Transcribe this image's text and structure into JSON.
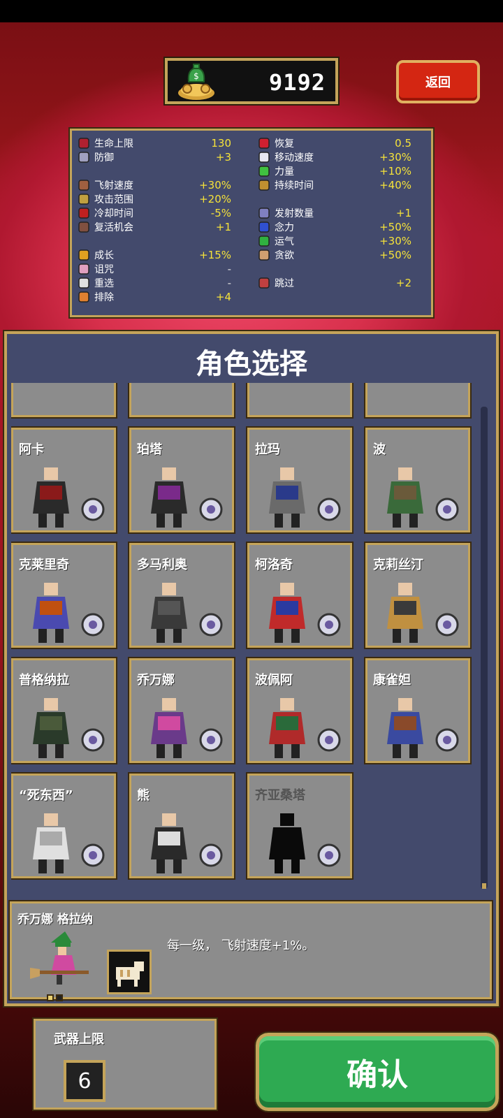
{
  "header": {
    "gold": "9192",
    "back_label": "返回"
  },
  "stats": {
    "left": [
      {
        "label": "生命上限",
        "value": "130",
        "icon": "heart-icon"
      },
      {
        "label": "防御",
        "value": "+3",
        "icon": "armor-icon"
      },
      {
        "label": "飞射速度",
        "value": "+30%",
        "icon": "boot-icon"
      },
      {
        "label": "攻击范围",
        "value": "+20%",
        "icon": "candelabra-icon"
      },
      {
        "label": "冷却时间",
        "value": "-5%",
        "icon": "clock-icon"
      },
      {
        "label": "复活机会",
        "value": "+1",
        "icon": "revival-icon"
      },
      {
        "label": "成长",
        "value": "+15%",
        "icon": "crown-icon"
      },
      {
        "label": "诅咒",
        "value": "-",
        "icon": "skull-icon"
      },
      {
        "label": "重选",
        "value": "-",
        "icon": "dice-icon"
      },
      {
        "label": "排除",
        "value": "+4",
        "icon": "banish-icon"
      }
    ],
    "right": [
      {
        "label": "恢复",
        "value": "0.5",
        "icon": "recovery-heart-icon"
      },
      {
        "label": "移动速度",
        "value": "+30%",
        "icon": "wing-icon"
      },
      {
        "label": "力量",
        "value": "+10%",
        "icon": "leaf-icon"
      },
      {
        "label": "持续时间",
        "value": "+40%",
        "icon": "hourglass-icon"
      },
      {
        "label": "发射数量",
        "value": "+1",
        "icon": "duplicator-icon"
      },
      {
        "label": "念力",
        "value": "+50%",
        "icon": "orb-icon"
      },
      {
        "label": "运气",
        "value": "+30%",
        "icon": "clover-icon"
      },
      {
        "label": "贪欲",
        "value": "+50%",
        "icon": "greed-mask-icon"
      },
      {
        "label": "跳过",
        "value": "+2",
        "icon": "skip-icon"
      }
    ]
  },
  "panel": {
    "title": "角色选择"
  },
  "characters": [
    {
      "name": "阿卡",
      "locked": false,
      "weapon": "fire-wand-icon"
    },
    {
      "name": "珀塔",
      "locked": false,
      "weapon": "magic-orb-icon"
    },
    {
      "name": "拉玛",
      "locked": false,
      "weapon": "axe-icon"
    },
    {
      "name": "波",
      "locked": false,
      "weapon": "garlic-icon"
    },
    {
      "name": "克莱里奇",
      "locked": false,
      "weapon": "holy-water-icon"
    },
    {
      "name": "多马利奥",
      "locked": false,
      "weapon": "bible-icon"
    },
    {
      "name": "柯洛奇",
      "locked": false,
      "weapon": "cross-icon"
    },
    {
      "name": "克莉丝汀",
      "locked": false,
      "weapon": "pentagram-icon"
    },
    {
      "name": "普格纳拉",
      "locked": false,
      "weapon": "pistol-icon"
    },
    {
      "name": "乔万娜",
      "locked": false,
      "weapon": "cat-icon"
    },
    {
      "name": "波佩阿",
      "locked": false,
      "weapon": "song-scroll-icon"
    },
    {
      "name": "康雀妲",
      "locked": false,
      "weapon": "laurel-icon"
    },
    {
      "name": "“死东西”",
      "locked": false,
      "weapon": "bone-icon"
    },
    {
      "name": "熊",
      "locked": false,
      "weapon": "shield-icon"
    },
    {
      "name": "齐亚桑塔",
      "locked": true,
      "weapon": "whip-icon"
    }
  ],
  "detail": {
    "full_name": "乔万娜 格拉纳",
    "description": "每一级， 飞射速度+1%。"
  },
  "footer": {
    "weapon_limit_label": "武器上限",
    "weapon_limit_value": "6",
    "confirm_label": "确认"
  }
}
